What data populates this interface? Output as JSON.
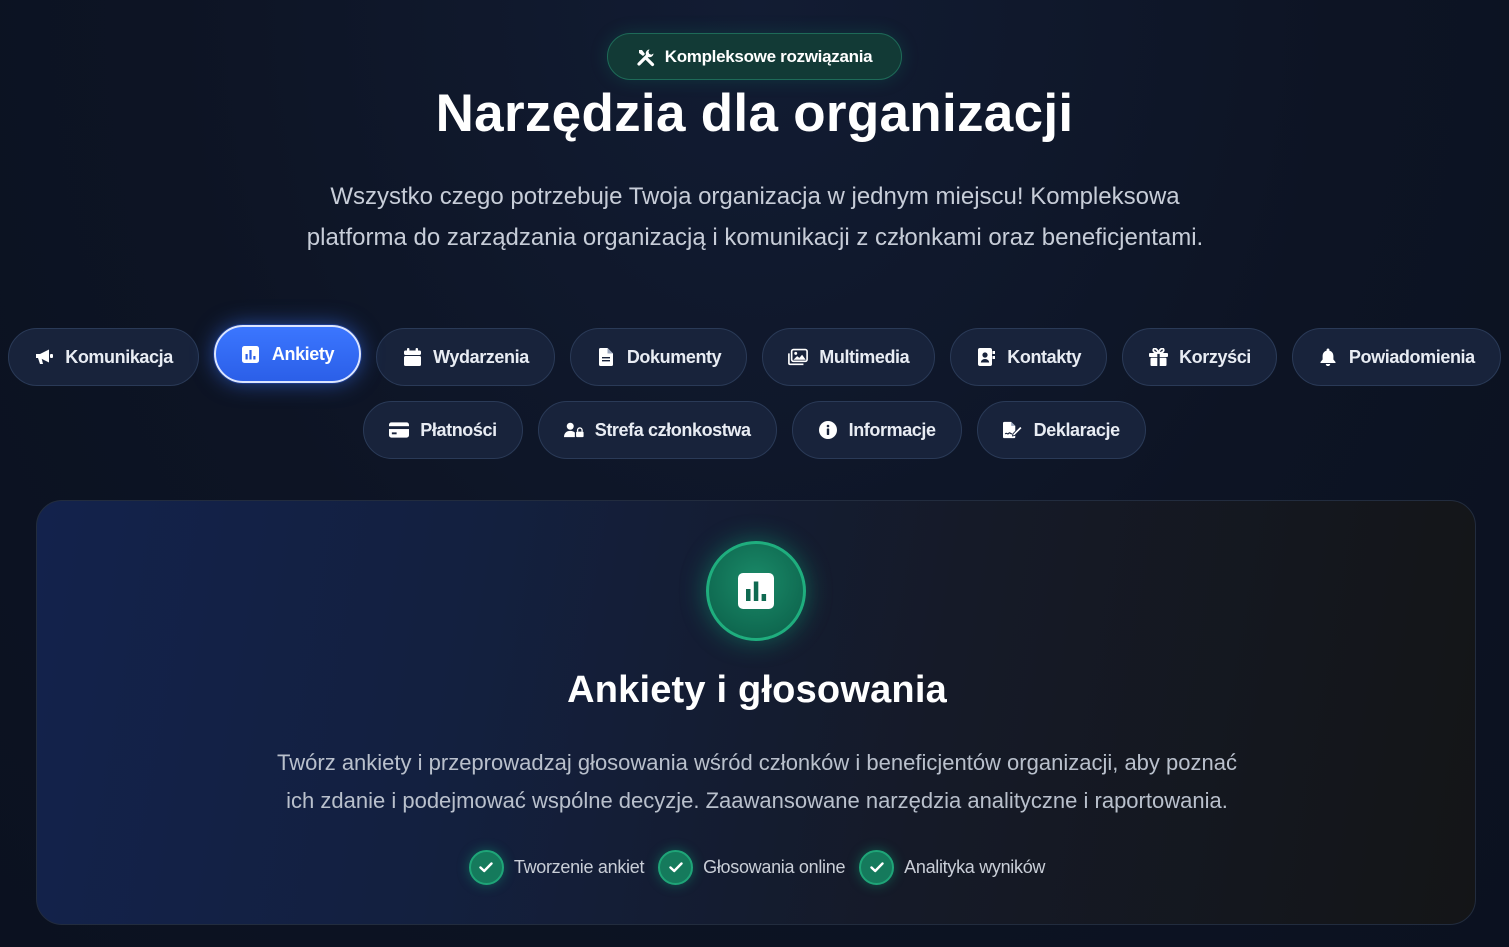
{
  "badge": {
    "label": "Kompleksowe rozwiązania",
    "icon": "tools-icon"
  },
  "title": "Narzędzia dla organizacji",
  "subtitle": {
    "line1": "Wszystko czego potrzebuje Twoja organizacja w jednym miejscu! Kompleksowa",
    "line2": "platforma do zarządzania organizacją i komunikacji z członkami oraz beneficjentami."
  },
  "tabs": {
    "row1": [
      {
        "label": "Komunikacja",
        "icon": "megaphone-icon"
      },
      {
        "label": "Ankiety",
        "icon": "poll-chart-icon",
        "active": true
      },
      {
        "label": "Wydarzenia",
        "icon": "calendar-icon"
      },
      {
        "label": "Dokumenty",
        "icon": "document-icon"
      },
      {
        "label": "Multimedia",
        "icon": "images-icon"
      },
      {
        "label": "Kontakty",
        "icon": "address-book-icon"
      },
      {
        "label": "Korzyści",
        "icon": "gift-icon"
      },
      {
        "label": "Powiadomienia",
        "icon": "bell-icon"
      }
    ],
    "row2": [
      {
        "label": "Płatności",
        "icon": "credit-card-icon"
      },
      {
        "label": "Strefa członkostwa",
        "icon": "user-lock-icon"
      },
      {
        "label": "Informacje",
        "icon": "info-icon"
      },
      {
        "label": "Deklaracje",
        "icon": "signature-icon"
      }
    ]
  },
  "panel": {
    "icon": "poll-chart-icon",
    "title": "Ankiety i głosowania",
    "desc_line1": "Twórz ankiety i przeprowadzaj głosowania wśród członków i beneficjentów organizacji, aby poznać",
    "desc_line2": "ich zdanie i podejmować wspólne decyzje. Zaawansowane narzędzia analityczne i raportowania.",
    "features": [
      "Tworzenie ankiet",
      "Głosowania online",
      "Analityka wyników"
    ]
  },
  "colors": {
    "accent_blue": "#3b76ff",
    "accent_green": "#10b981",
    "background": "#0d1424"
  }
}
